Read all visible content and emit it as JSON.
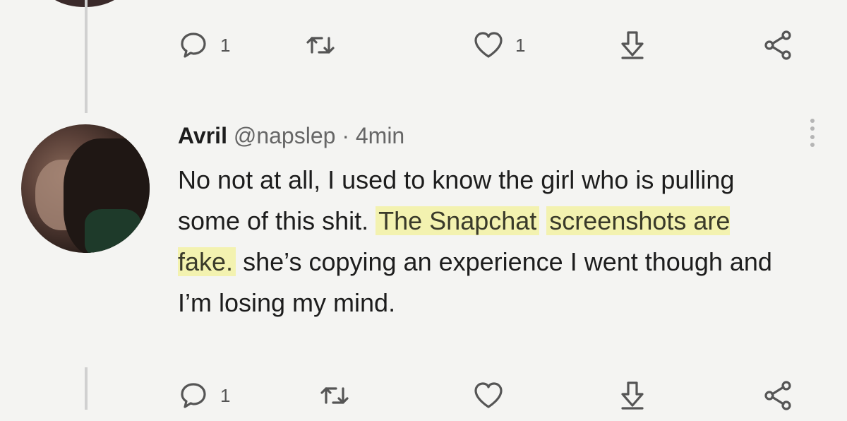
{
  "previous_tweet": {
    "actions": {
      "reply_count": "1",
      "like_count": "1"
    }
  },
  "tweet": {
    "author": {
      "name": "Avril",
      "handle": "@napslep"
    },
    "separator": "·",
    "time": "4min",
    "text_before": "No not at all, I used to know the girl who is pulling some of this shit.",
    "text_highlight_1": "The Snapchat",
    "text_highlight_2": "screenshots are fake.",
    "text_after": "she’s copying an experience I went though and I’m losing my mind.",
    "actions": {
      "reply_count": "1"
    }
  },
  "colors": {
    "highlight": "#f3f2b0",
    "background": "#f4f4f2",
    "icon": "#555555"
  },
  "icons": [
    "reply-icon",
    "retweet-icon",
    "like-icon",
    "download-icon",
    "share-icon",
    "more-icon"
  ]
}
